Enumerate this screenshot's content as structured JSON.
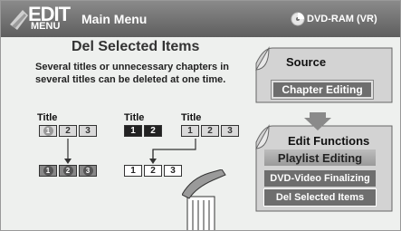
{
  "header": {
    "logo_edit": "EDIT",
    "logo_menu": "MENU",
    "title": "Main Menu",
    "disc_type": "DVD-RAM (VR)",
    "disc_icon": "disc-icon"
  },
  "left": {
    "heading": "Del Selected Items",
    "description": "Several titles or unnecessary chapters in several titles can be deleted at one time.",
    "title_labels": [
      "Title",
      "Title",
      "Title"
    ],
    "top_groups": [
      {
        "chapters": [
          "1",
          "2",
          "3"
        ]
      },
      {
        "chapters": [
          "1",
          "2"
        ]
      },
      {
        "chapters": [
          "1",
          "2",
          "3"
        ]
      }
    ],
    "bottom_groups": [
      {
        "chapters": [
          "1",
          "2",
          "3"
        ]
      },
      {
        "chapters": [
          "1",
          "2",
          "3"
        ]
      }
    ]
  },
  "right": {
    "source_title": "Source",
    "source_button": "Chapter Editing",
    "functions_title": "Edit Functions",
    "functions": [
      "Playlist Editing",
      "DVD-Video Finalizing",
      "Del Selected Items"
    ],
    "selected_function": "Del Selected Items"
  },
  "colors": {
    "header": "#6f6f6f",
    "background": "#eef0ee",
    "button_dark": "#6e6e6e"
  }
}
